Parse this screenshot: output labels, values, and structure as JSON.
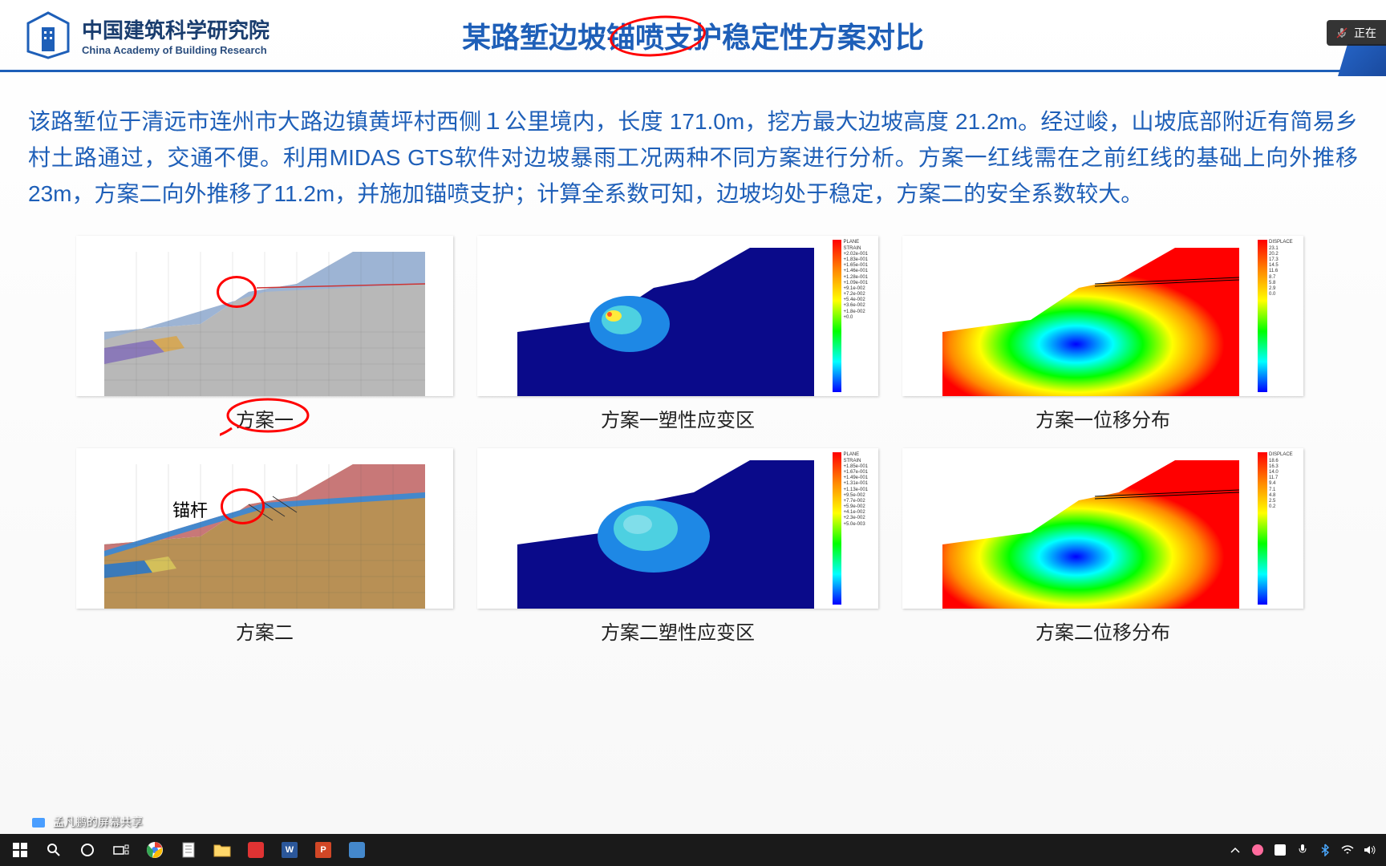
{
  "header": {
    "org_cn": "中国建筑科学研究院",
    "org_en": "China Academy of Building Research",
    "title": "某路堑边坡锚喷支护稳定性方案对比"
  },
  "content": {
    "description": "该路堑位于清远市连州市大路边镇黄坪村西侧１公里境内，长度 171.0m，挖方最大边坡高度 21.2m。经过峻，山坡底部附近有简易乡村土路通过，交通不便。利用MIDAS GTS软件对边坡暴雨工况两种不同方案进行分析。方案一红线需在之前红线的基础上向外推移23m，方案二向外推移了11.2m，并施加锚喷支护；计算全系数可知，边坡均处于稳定，方案二的安全系数较大。"
  },
  "figures": {
    "f1": {
      "caption": "方案一",
      "anchor_label": ""
    },
    "f2": {
      "caption": "方案一塑性应变区"
    },
    "f3": {
      "caption": "方案一位移分布"
    },
    "f4": {
      "caption": "方案二",
      "anchor_label": "锚杆"
    },
    "f5": {
      "caption": "方案二塑性应变区"
    },
    "f6": {
      "caption": "方案二位移分布"
    }
  },
  "meeting": {
    "status": "正在",
    "share_text": "孟凡鹏的屏幕共享"
  },
  "taskbar": {
    "time": "",
    "icons": [
      "start",
      "search",
      "cortana",
      "taskview",
      "chrome",
      "file",
      "explorer",
      "app1",
      "word",
      "ppt",
      "app2"
    ]
  }
}
